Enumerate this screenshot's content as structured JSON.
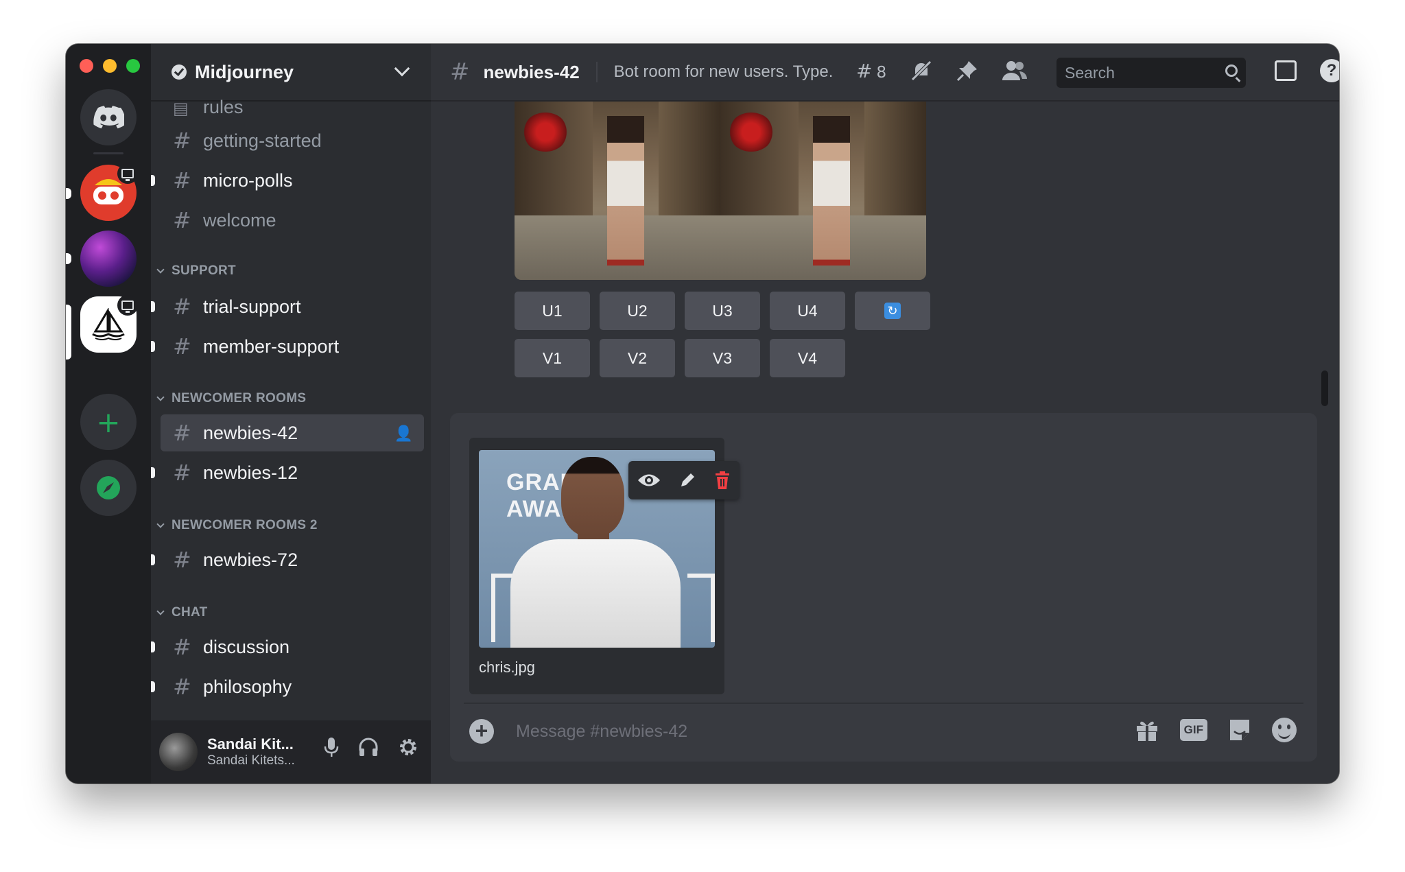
{
  "server": {
    "name": "Midjourney"
  },
  "channels": {
    "top": [
      {
        "label": "rules"
      },
      {
        "label": "getting-started"
      },
      {
        "label": "micro-polls"
      },
      {
        "label": "welcome"
      }
    ],
    "categories": [
      {
        "name": "SUPPORT",
        "items": [
          {
            "label": "trial-support"
          },
          {
            "label": "member-support"
          }
        ]
      },
      {
        "name": "NEWCOMER ROOMS",
        "items": [
          {
            "label": "newbies-42"
          },
          {
            "label": "newbies-12"
          }
        ]
      },
      {
        "name": "NEWCOMER ROOMS 2",
        "items": [
          {
            "label": "newbies-72"
          }
        ]
      },
      {
        "name": "CHAT",
        "items": [
          {
            "label": "discussion"
          },
          {
            "label": "philosophy"
          }
        ]
      }
    ]
  },
  "user": {
    "name": "Sandai Kit...",
    "status": "Sandai Kitets..."
  },
  "topbar": {
    "channel": "newbies-42",
    "topic": "Bot room for new users. Type...",
    "threads_count": "8",
    "search_placeholder": "Search"
  },
  "generation": {
    "upscale_buttons": [
      "U1",
      "U2",
      "U3",
      "U4"
    ],
    "variation_buttons": [
      "V1",
      "V2",
      "V3",
      "V4"
    ]
  },
  "composer": {
    "attachment_filename": "chris.jpg",
    "attachment_image_text": "GRAMMY AWARDS",
    "placeholder": "Message #newbies-42",
    "gif_label": "GIF"
  },
  "colors": {
    "close": "#ff5f57",
    "minimize": "#febc2e",
    "zoom": "#28c840",
    "brand": "#5865f2",
    "danger": "#f23f43",
    "online_green": "#23a55a"
  },
  "icons": {
    "home": "discord-logo-icon",
    "add_server": "plus-icon",
    "explore": "compass-icon"
  }
}
